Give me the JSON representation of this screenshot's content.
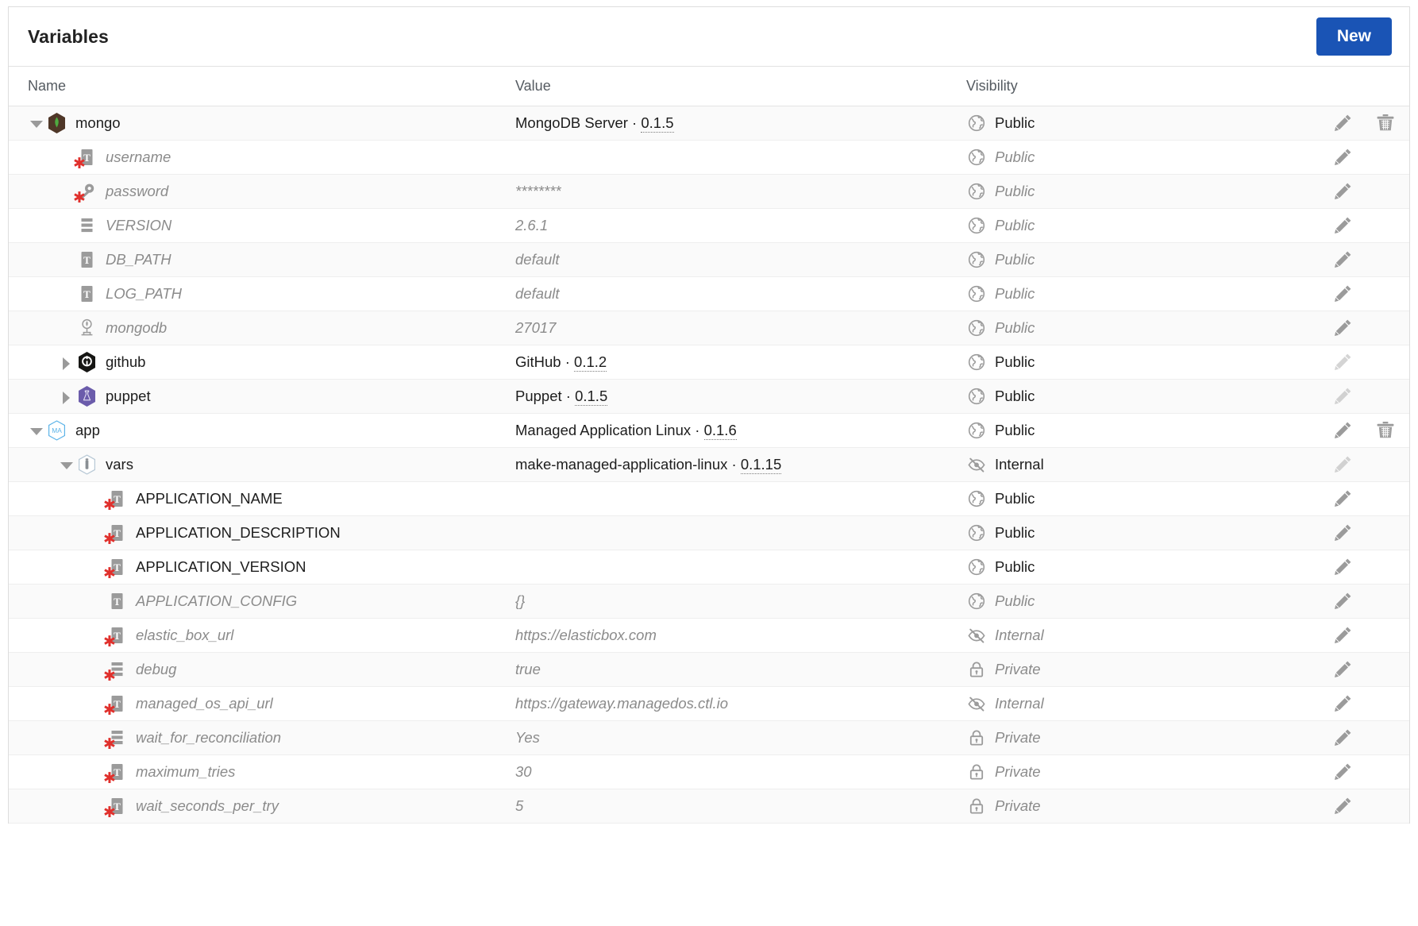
{
  "header": {
    "title": "Variables",
    "new_button": "New"
  },
  "columns": {
    "name": "Name",
    "value": "Value",
    "visibility": "Visibility"
  },
  "visibility_labels": {
    "public": "Public",
    "internal": "Internal",
    "private": "Private"
  },
  "colors": {
    "accent_button": "#1a54b5",
    "mongo_icon": "#4f3728",
    "mongo_leaf": "#4faa41",
    "github_icon": "#161614",
    "puppet_icon": "#6b5cab",
    "managed_app_icon": "#5cb3e8",
    "required_asterisk": "#e0302c",
    "muted_text": "#8b8b8b"
  },
  "rows": [
    {
      "name": "mongo",
      "level": 0,
      "twisty": "open",
      "icon": "mongodb-icon",
      "required": false,
      "value_text": "MongoDB Server",
      "value_version": "0.1.5",
      "visibility": "Public",
      "visibility_icon": "globe-icon",
      "muted": false,
      "edit": true,
      "edit_dim": false,
      "delete": true
    },
    {
      "name": "username",
      "level": 1,
      "twisty": "none",
      "icon": "text-variable-icon",
      "required": true,
      "value_text": "",
      "value_version": "",
      "visibility": "Public",
      "visibility_icon": "globe-icon",
      "muted": true,
      "edit": true,
      "edit_dim": false,
      "delete": false
    },
    {
      "name": "password",
      "level": 1,
      "twisty": "none",
      "icon": "key-icon",
      "required": true,
      "value_text": "********",
      "value_version": "",
      "visibility": "Public",
      "visibility_icon": "globe-icon",
      "muted": true,
      "edit": true,
      "edit_dim": false,
      "delete": false
    },
    {
      "name": "VERSION",
      "level": 1,
      "twisty": "none",
      "icon": "options-list-icon",
      "required": false,
      "value_text": "2.6.1",
      "value_version": "",
      "visibility": "Public",
      "visibility_icon": "globe-icon",
      "muted": true,
      "edit": true,
      "edit_dim": false,
      "delete": false
    },
    {
      "name": "DB_PATH",
      "level": 1,
      "twisty": "none",
      "icon": "text-variable-icon",
      "required": false,
      "value_text": "default",
      "value_version": "",
      "visibility": "Public",
      "visibility_icon": "globe-icon",
      "muted": true,
      "edit": true,
      "edit_dim": false,
      "delete": false
    },
    {
      "name": "LOG_PATH",
      "level": 1,
      "twisty": "none",
      "icon": "text-variable-icon",
      "required": false,
      "value_text": "default",
      "value_version": "",
      "visibility": "Public",
      "visibility_icon": "globe-icon",
      "muted": true,
      "edit": true,
      "edit_dim": false,
      "delete": false
    },
    {
      "name": "mongodb",
      "level": 1,
      "twisty": "none",
      "icon": "port-icon",
      "required": false,
      "value_text": "27017",
      "value_version": "",
      "visibility": "Public",
      "visibility_icon": "globe-icon",
      "muted": true,
      "edit": true,
      "edit_dim": false,
      "delete": false
    },
    {
      "name": "github",
      "level": 1,
      "twisty": "closed",
      "icon": "github-icon",
      "required": false,
      "value_text": "GitHub",
      "value_version": "0.1.2",
      "visibility": "Public",
      "visibility_icon": "globe-icon",
      "muted": false,
      "edit": true,
      "edit_dim": true,
      "delete": false
    },
    {
      "name": "puppet",
      "level": 1,
      "twisty": "closed",
      "icon": "puppet-icon",
      "required": false,
      "value_text": "Puppet",
      "value_version": "0.1.5",
      "visibility": "Public",
      "visibility_icon": "globe-icon",
      "muted": false,
      "edit": true,
      "edit_dim": true,
      "delete": false
    },
    {
      "name": "app",
      "level": 0,
      "twisty": "open",
      "icon": "managed-app-icon",
      "required": false,
      "value_text": "Managed Application Linux",
      "value_version": "0.1.6",
      "visibility": "Public",
      "visibility_icon": "globe-icon",
      "muted": false,
      "edit": true,
      "edit_dim": false,
      "delete": true
    },
    {
      "name": "vars",
      "level": 1,
      "twisty": "open",
      "icon": "box-icon",
      "required": false,
      "value_text": "make-managed-application-linux",
      "value_version": "0.1.15",
      "visibility": "Internal",
      "visibility_icon": "eye-slash-icon",
      "muted": false,
      "edit": true,
      "edit_dim": true,
      "delete": false
    },
    {
      "name": "APPLICATION_NAME",
      "level": 2,
      "twisty": "none",
      "icon": "text-variable-icon",
      "required": true,
      "value_text": "",
      "value_version": "",
      "visibility": "Public",
      "visibility_icon": "globe-icon",
      "muted": false,
      "edit": true,
      "edit_dim": false,
      "delete": false
    },
    {
      "name": "APPLICATION_DESCRIPTION",
      "level": 2,
      "twisty": "none",
      "icon": "text-variable-icon",
      "required": true,
      "value_text": "",
      "value_version": "",
      "visibility": "Public",
      "visibility_icon": "globe-icon",
      "muted": false,
      "edit": true,
      "edit_dim": false,
      "delete": false
    },
    {
      "name": "APPLICATION_VERSION",
      "level": 2,
      "twisty": "none",
      "icon": "text-variable-icon",
      "required": true,
      "value_text": "",
      "value_version": "",
      "visibility": "Public",
      "visibility_icon": "globe-icon",
      "muted": false,
      "edit": true,
      "edit_dim": false,
      "delete": false
    },
    {
      "name": "APPLICATION_CONFIG",
      "level": 2,
      "twisty": "none",
      "icon": "text-variable-icon",
      "required": false,
      "value_text": "{}",
      "value_version": "",
      "visibility": "Public",
      "visibility_icon": "globe-icon",
      "muted": true,
      "edit": true,
      "edit_dim": false,
      "delete": false
    },
    {
      "name": "elastic_box_url",
      "level": 2,
      "twisty": "none",
      "icon": "text-variable-icon",
      "required": true,
      "value_text": "https://elasticbox.com",
      "value_version": "",
      "visibility": "Internal",
      "visibility_icon": "eye-slash-icon",
      "muted": true,
      "edit": true,
      "edit_dim": false,
      "delete": false
    },
    {
      "name": "debug",
      "level": 2,
      "twisty": "none",
      "icon": "options-list-icon",
      "required": true,
      "value_text": "true",
      "value_version": "",
      "visibility": "Private",
      "visibility_icon": "lock-icon",
      "muted": true,
      "edit": true,
      "edit_dim": false,
      "delete": false
    },
    {
      "name": "managed_os_api_url",
      "level": 2,
      "twisty": "none",
      "icon": "text-variable-icon",
      "required": true,
      "value_text": "https://gateway.managedos.ctl.io",
      "value_version": "",
      "visibility": "Internal",
      "visibility_icon": "eye-slash-icon",
      "muted": true,
      "edit": true,
      "edit_dim": false,
      "delete": false
    },
    {
      "name": "wait_for_reconciliation",
      "level": 2,
      "twisty": "none",
      "icon": "options-list-icon",
      "required": true,
      "value_text": "Yes",
      "value_version": "",
      "visibility": "Private",
      "visibility_icon": "lock-icon",
      "muted": true,
      "edit": true,
      "edit_dim": false,
      "delete": false
    },
    {
      "name": "maximum_tries",
      "level": 2,
      "twisty": "none",
      "icon": "text-variable-icon",
      "required": true,
      "value_text": "30",
      "value_version": "",
      "visibility": "Private",
      "visibility_icon": "lock-icon",
      "muted": true,
      "edit": true,
      "edit_dim": false,
      "delete": false
    },
    {
      "name": "wait_seconds_per_try",
      "level": 2,
      "twisty": "none",
      "icon": "text-variable-icon",
      "required": true,
      "value_text": "5",
      "value_version": "",
      "visibility": "Private",
      "visibility_icon": "lock-icon",
      "muted": true,
      "edit": true,
      "edit_dim": false,
      "delete": false
    }
  ]
}
